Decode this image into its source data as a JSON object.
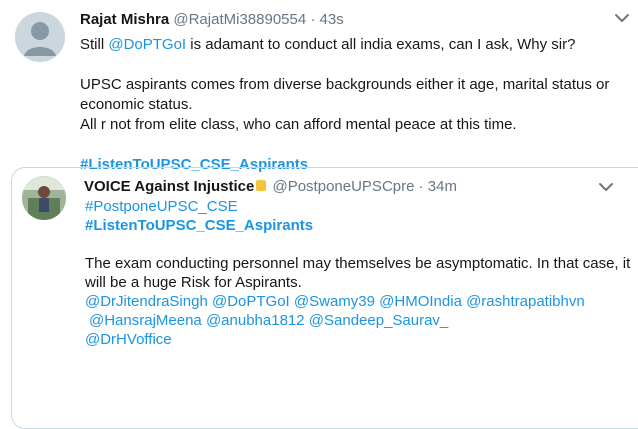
{
  "tweet": {
    "author_name": "Rajat Mishra",
    "author_handle": "@RajatMi38890554",
    "separator": "·",
    "time": "43s",
    "text_line1_before": "Still ",
    "text_line1_mention": "@DoPTGoI",
    "text_line1_after": " is adamant to conduct all india exams, can I ask, Why sir?",
    "text_para2": "UPSC aspirants comes from diverse backgrounds either it age, marital status or economic status.",
    "text_para3": "All r not from elite class, who can afford mental peace at this time.",
    "hashtag": "#ListenToUPSC_CSE_Aspirants",
    "avatar_icon": "default-avatar-icon",
    "menu_icon": "chevron-down-icon"
  },
  "quoted": {
    "author_name": "VOICE Against Injustice",
    "author_emoji_icon": "raised-fist-icon",
    "author_handle": "@PostponeUPSCpre",
    "separator": "·",
    "time": "34m",
    "hashtag1": "#PostponeUPSC_CSE",
    "hashtag2": "#ListenToUPSC_CSE_Aspirants",
    "body": "The exam conducting personnel may themselves be asymptomatic. In that case, it will be a huge Risk for Aspirants.",
    "mentions": [
      "@DrJitendraSingh",
      "@DoPTGoI",
      "@Swamy39",
      "@HMOIndia",
      "@rashtrapatibhvn",
      "@HansrajMeena",
      "@anubha1812",
      "@Sandeep_Saurav_",
      "@DrHVoffice"
    ],
    "menu_icon": "chevron-down-icon"
  },
  "colors": {
    "link": "#1b95e0",
    "secondary_text": "#657786",
    "primary_text": "#14171a",
    "border": "#ccd6dd"
  }
}
